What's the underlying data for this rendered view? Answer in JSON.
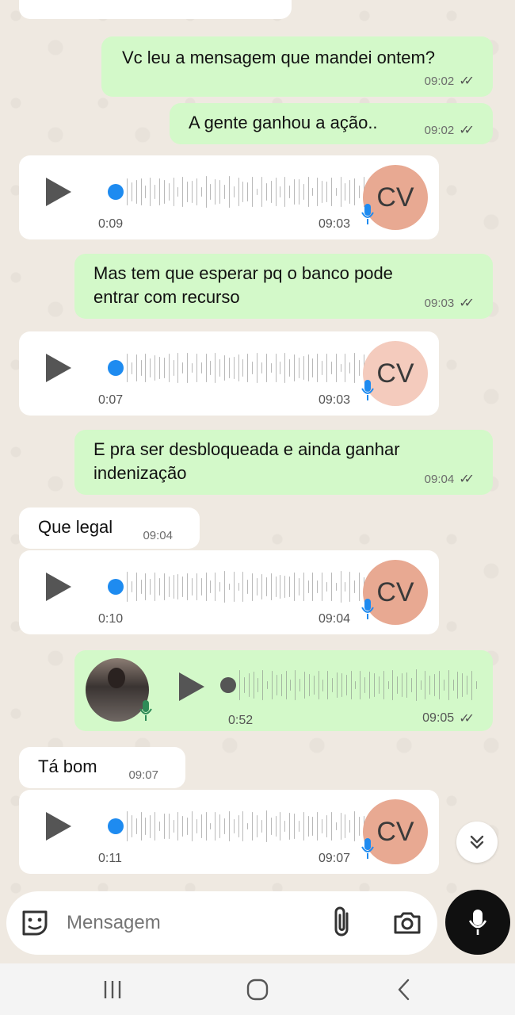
{
  "composer": {
    "placeholder": "Mensagem"
  },
  "icons": {
    "emoji": "sticker-emoji-icon",
    "attach": "paperclip-icon",
    "camera": "camera-icon",
    "mic": "microphone-icon",
    "scroll": "double-chevron-down-icon",
    "nav_recents": "recent-apps-icon",
    "nav_home": "home-icon",
    "nav_back": "back-icon"
  },
  "colors": {
    "outgoing_bubble": "#d3f9c9",
    "incoming_bubble": "#ffffff",
    "voice_dot": "#1e8bf0",
    "avatar": "#e8a992"
  },
  "messages": [
    {
      "type": "text",
      "dir": "out",
      "text": "Vc leu a mensagem que mandei ontem?",
      "time": "09:02",
      "ticks": "✓✓"
    },
    {
      "type": "text",
      "dir": "out",
      "text": "A gente ganhou a ação..",
      "time": "09:02",
      "ticks": "✓✓"
    },
    {
      "type": "voice",
      "dir": "in",
      "duration": "0:09",
      "time": "09:03",
      "avatar": "CV"
    },
    {
      "type": "text",
      "dir": "out",
      "text": "Mas tem que esperar pq o banco pode\nentrar com recurso",
      "time": "09:03",
      "ticks": "✓✓"
    },
    {
      "type": "voice",
      "dir": "in",
      "duration": "0:07",
      "time": "09:03",
      "avatar": "CV"
    },
    {
      "type": "text",
      "dir": "out",
      "text": "E pra ser desbloqueada e ainda ganhar\nindenização",
      "time": "09:04",
      "ticks": "✓✓"
    },
    {
      "type": "text",
      "dir": "in",
      "text": "Que legal",
      "time": "09:04"
    },
    {
      "type": "voice",
      "dir": "in",
      "duration": "0:10",
      "time": "09:04",
      "avatar": "CV"
    },
    {
      "type": "voice",
      "dir": "out",
      "duration": "0:52",
      "time": "09:05",
      "ticks": "✓✓"
    },
    {
      "type": "text",
      "dir": "in",
      "text": "Tá bom",
      "time": "09:07"
    },
    {
      "type": "voice",
      "dir": "in",
      "duration": "0:11",
      "time": "09:07",
      "avatar": "CV"
    }
  ]
}
